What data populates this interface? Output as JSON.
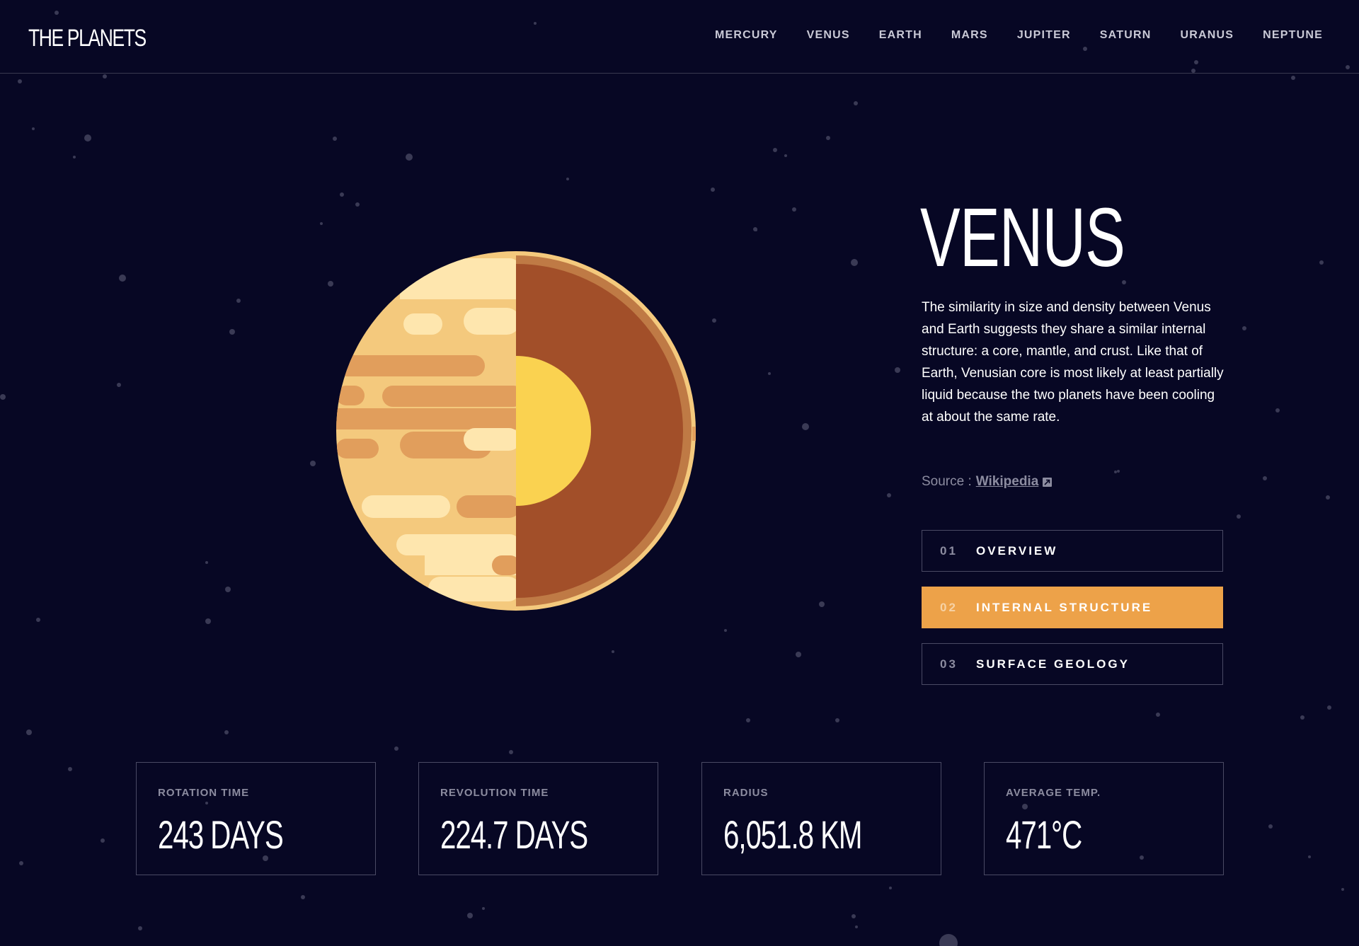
{
  "header": {
    "logo": "THE PLANETS",
    "nav": [
      "MERCURY",
      "VENUS",
      "EARTH",
      "MARS",
      "JUPITER",
      "SATURN",
      "URANUS",
      "NEPTUNE"
    ]
  },
  "planet": {
    "name": "VENUS",
    "description": "The similarity in size and density between Venus and Earth suggests they share a similar internal structure: a core, mantle, and crust. Like that of Earth, Venusian core is most likely at least partially liquid because the two planets have been cooling at about the same rate.",
    "source_prefix": "Source :",
    "source_link": "Wikipedia",
    "illustration": "venus-internal-structure-icon"
  },
  "tabs": [
    {
      "num": "01",
      "label": "OVERVIEW",
      "active": false
    },
    {
      "num": "02",
      "label": "INTERNAL STRUCTURE",
      "active": true
    },
    {
      "num": "03",
      "label": "SURFACE GEOLOGY",
      "active": false
    }
  ],
  "stats": [
    {
      "label": "ROTATION TIME",
      "value": "243 DAYS"
    },
    {
      "label": "REVOLUTION TIME",
      "value": "224.7 DAYS"
    },
    {
      "label": "RADIUS",
      "value": "6,051.8 KM"
    },
    {
      "label": "AVERAGE TEMP.",
      "value": "471°C"
    }
  ],
  "colors": {
    "background": "#070724",
    "accent": "#EDA249",
    "border": "#38384F",
    "muted": "#8C8CA0"
  }
}
